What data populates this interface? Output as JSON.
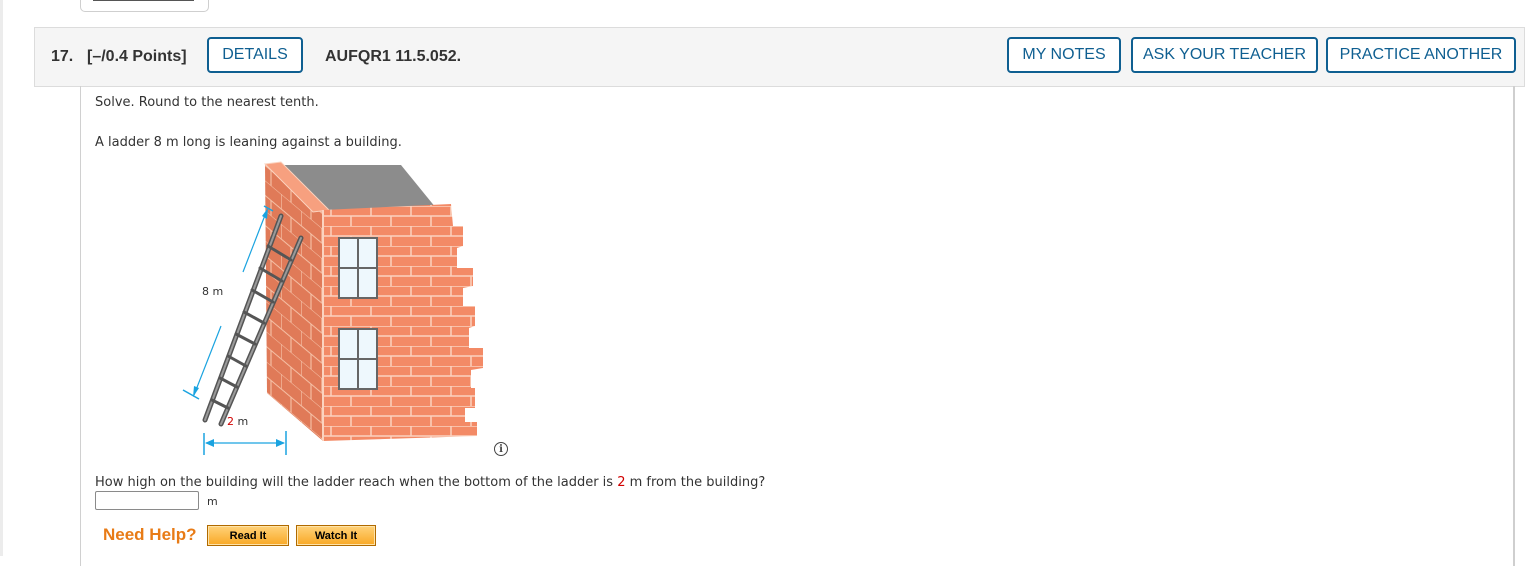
{
  "question": {
    "number": "17.",
    "points": "[–/0.4 Points]",
    "code": "AUFQR1 11.5.052.",
    "buttons": {
      "details": "DETAILS",
      "my_notes": "MY NOTES",
      "ask_teacher": "ASK YOUR TEACHER",
      "practice_another": "PRACTICE ANOTHER"
    },
    "instruction": "Solve. Round to the nearest tenth.",
    "setup": "A ladder 8 m long is leaning against a building.",
    "figure": {
      "ladder_label": "8 m",
      "base_value": "2",
      "base_unit": " m",
      "info_icon": "info-circle-icon"
    },
    "prompt": {
      "before": "How high on the building will the ladder reach when the bottom of the ladder is ",
      "value": "2",
      "after": " m from the building?"
    },
    "answer": {
      "value": "",
      "unit": "m"
    },
    "help": {
      "label": "Need Help?",
      "read_it": "Read It",
      "watch_it": "Watch It"
    }
  },
  "colors": {
    "accent": "#0f5f91",
    "need_help": "#e87b16",
    "highlight_red": "#d10000",
    "brick": "#f38a66",
    "brick_dark": "#e07a58",
    "roof": "#8c8c8c",
    "dimension": "#1aa3e0"
  }
}
